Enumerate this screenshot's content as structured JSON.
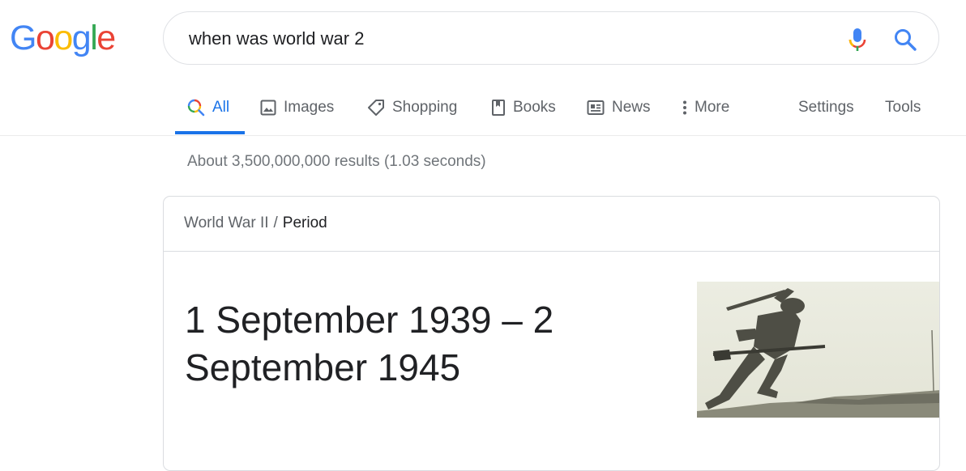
{
  "logo": {
    "letters": [
      {
        "char": "G",
        "color": "#4285F4"
      },
      {
        "char": "o",
        "color": "#EA4335"
      },
      {
        "char": "o",
        "color": "#FBBC05"
      },
      {
        "char": "g",
        "color": "#4285F4"
      },
      {
        "char": "l",
        "color": "#34A853"
      },
      {
        "char": "e",
        "color": "#EA4335"
      }
    ]
  },
  "search": {
    "query": "when was world war 2",
    "mic_icon": "microphone-icon",
    "search_icon": "search-icon"
  },
  "tabs": {
    "all": "All",
    "images": "Images",
    "shopping": "Shopping",
    "books": "Books",
    "news": "News",
    "more": "More",
    "settings": "Settings",
    "tools": "Tools"
  },
  "colors": {
    "accent": "#1a73e8",
    "text": "#202124",
    "muted": "#5f6368"
  },
  "result_stats": "About 3,500,000,000 results (1.03 seconds)",
  "answer_card": {
    "breadcrumb_parent": "World War II",
    "breadcrumb_separator": "/",
    "breadcrumb_current": "Period",
    "answer_line1": "1 September 1939 – 2",
    "answer_line2": "September 1945",
    "image_icon": "soldier-photo"
  }
}
